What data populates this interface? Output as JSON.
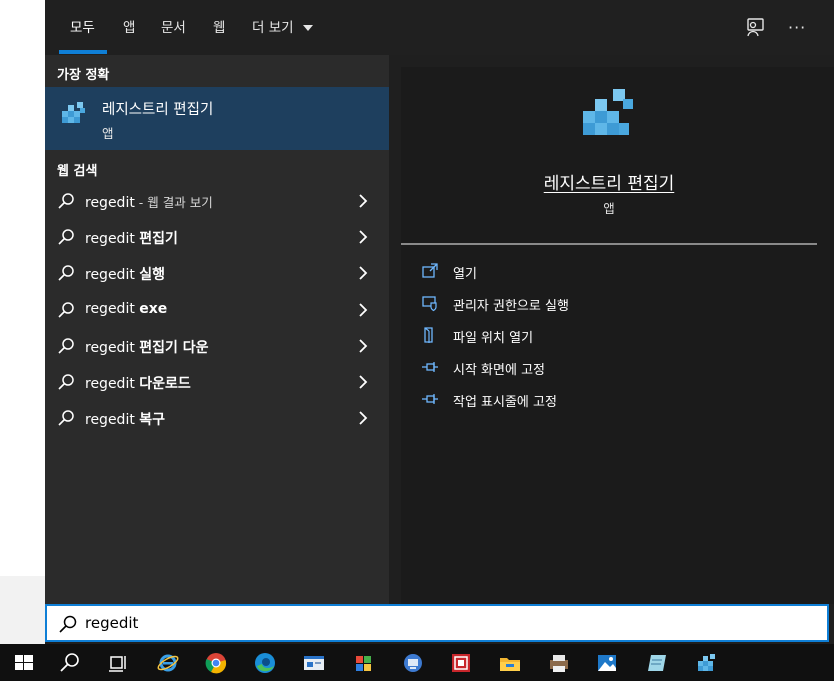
{
  "tabs": [
    {
      "label": "모두",
      "active": true
    },
    {
      "label": "앱"
    },
    {
      "label": "문서"
    },
    {
      "label": "웹"
    },
    {
      "label": "더 보기"
    }
  ],
  "header_icons": [
    "feedback-icon",
    "more-icon"
  ],
  "more_glyph": "···",
  "best_match": {
    "section_title": "가장 정확",
    "name": "레지스트리 편집기",
    "type": "앱",
    "icon": "registry-editor-icon"
  },
  "web_search": {
    "section_title": "웹 검색",
    "items": [
      {
        "prefix": "regedit",
        "suffix": " - 웹 결과 보기",
        "bold": false
      },
      {
        "prefix": "regedit",
        "suffix": "편집기",
        "bold": true
      },
      {
        "prefix": "regedit",
        "suffix": "실행",
        "bold": true
      },
      {
        "prefix": "regedit",
        "suffix": "exe",
        "bold": true
      },
      {
        "prefix": "regedit",
        "suffix": "편집기 다운",
        "bold": true
      },
      {
        "prefix": "regedit",
        "suffix": "다운로드",
        "bold": true
      },
      {
        "prefix": "regedit",
        "suffix": "복구",
        "bold": true
      }
    ]
  },
  "preview": {
    "title": "레지스트리 편집기",
    "type": "앱",
    "actions": [
      {
        "label": "열기",
        "icon": "open-icon"
      },
      {
        "label": "관리자 권한으로 실행",
        "icon": "run-as-admin-icon"
      },
      {
        "label": "파일 위치 열기",
        "icon": "file-location-icon"
      },
      {
        "label": "시작 화면에 고정",
        "icon": "pin-icon"
      },
      {
        "label": "작업 표시줄에 고정",
        "icon": "pin-icon"
      }
    ]
  },
  "search": {
    "value": "regedit"
  },
  "taskbar": [
    "windows-start-icon",
    "search-icon",
    "task-view-icon",
    "internet-explorer-icon",
    "chrome-icon",
    "edge-icon",
    "window-app-icon",
    "paint-icon",
    "computer-management-icon",
    "red-app-icon",
    "file-explorer-icon",
    "printer-app-icon",
    "photos-icon",
    "sticky-notes-icon",
    "registry-editor-icon"
  ],
  "colors": {
    "accent": "#0f7fd6",
    "selected_bg": "#1e3f5e",
    "panel_bg": "#2b2b2b",
    "preview_bg": "#1b1b1b"
  }
}
